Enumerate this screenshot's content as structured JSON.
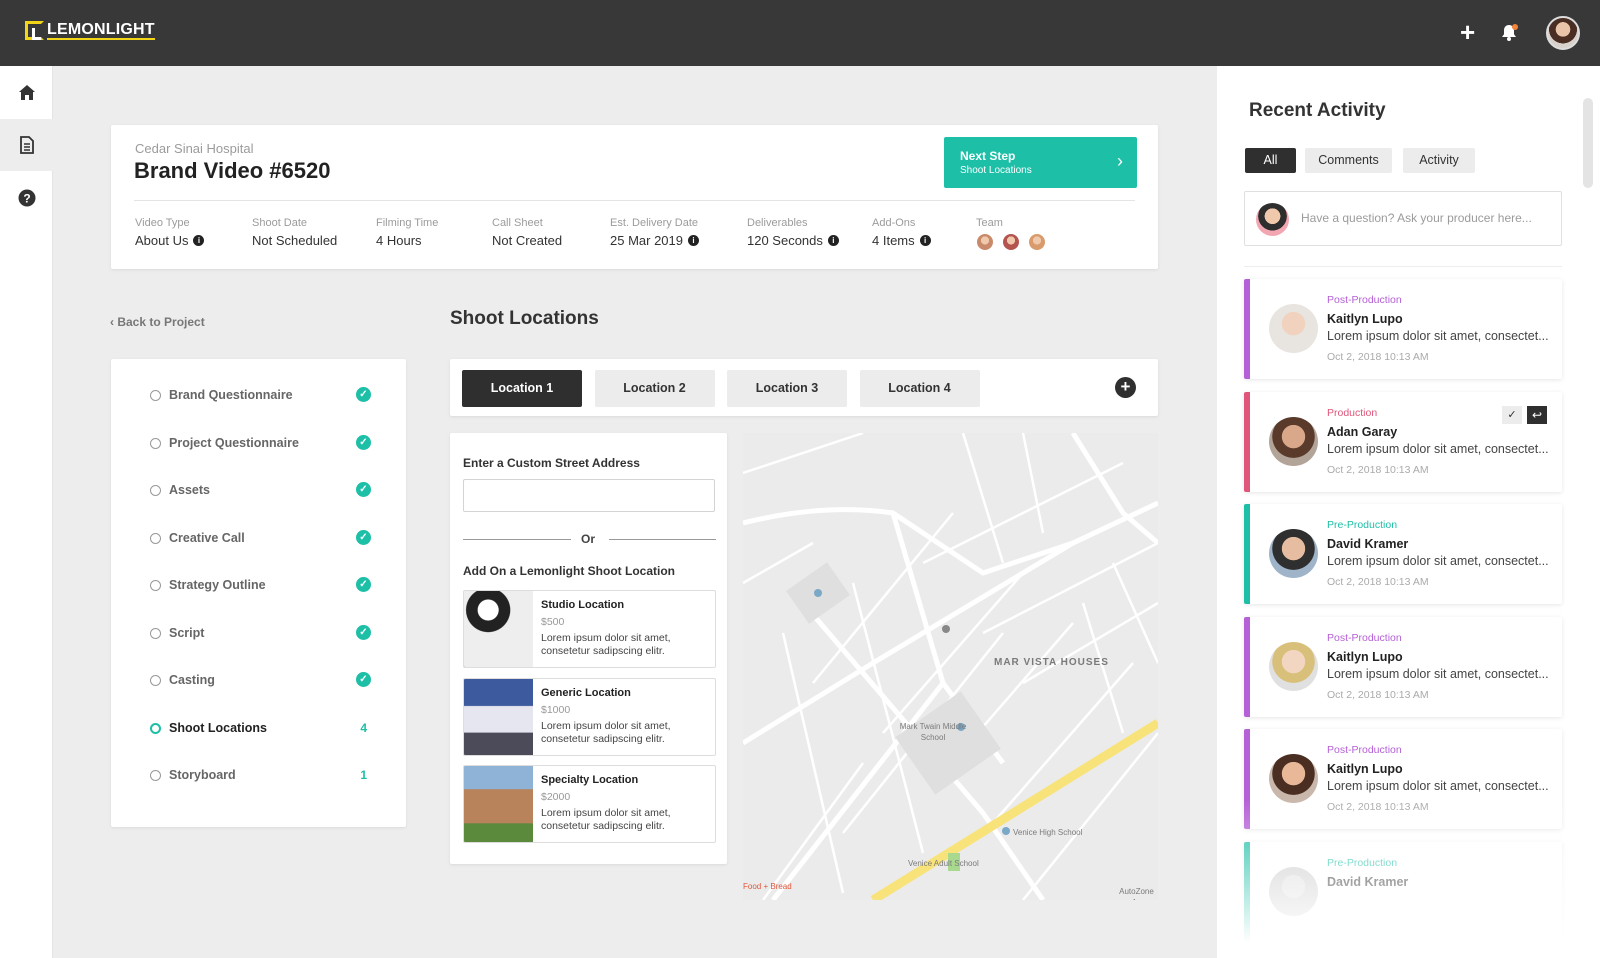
{
  "app": {
    "brand": "LEMONLIGHT"
  },
  "header": {
    "client": "Cedar Sinai Hospital",
    "title": "Brand Video #6520",
    "next_step": {
      "label": "Next Step",
      "sub": "Shoot Locations"
    },
    "meta": [
      {
        "key": "Video Type",
        "value": "About Us",
        "info": true
      },
      {
        "key": "Shoot Date",
        "value": "Not Scheduled",
        "info": false
      },
      {
        "key": "Filming Time",
        "value": "4 Hours",
        "info": false
      },
      {
        "key": "Call Sheet",
        "value": "Not Created",
        "info": false
      },
      {
        "key": "Est. Delivery Date",
        "value": "25 Mar 2019",
        "info": true
      },
      {
        "key": "Deliverables",
        "value": "120 Seconds",
        "info": true
      },
      {
        "key": "Add-Ons",
        "value": "4 Items",
        "info": true
      },
      {
        "key": "Team",
        "value": "",
        "info": false
      }
    ]
  },
  "nav": {
    "back": "Back to Project"
  },
  "steps": [
    {
      "label": "Brand Questionnaire",
      "done": true
    },
    {
      "label": "Project Questionnaire",
      "done": true
    },
    {
      "label": "Assets",
      "done": true
    },
    {
      "label": "Creative Call",
      "done": true
    },
    {
      "label": "Strategy Outline",
      "done": true
    },
    {
      "label": "Script",
      "done": true
    },
    {
      "label": "Casting",
      "done": true
    },
    {
      "label": "Shoot Locations",
      "done": false,
      "count": "4",
      "current": true
    },
    {
      "label": "Storyboard",
      "done": false,
      "count": "1"
    }
  ],
  "main": {
    "title": "Shoot Locations",
    "tabs": [
      "Location 1",
      "Location 2",
      "Location 3",
      "Location 4"
    ],
    "address_label": "Enter a Custom Street Address",
    "or": "Or",
    "addon_label": "Add On a Lemonlight Shoot Location",
    "locations": [
      {
        "name": "Studio Location",
        "price": "$500",
        "desc": "Lorem ipsum dolor sit amet, consetetur sadipscing elitr."
      },
      {
        "name": "Generic Location",
        "price": "$1000",
        "desc": "Lorem ipsum dolor sit amet, consetetur sadipscing elitr."
      },
      {
        "name": "Specialty Location",
        "price": "$2000",
        "desc": "Lorem ipsum dolor sit amet, consetetur sadipscing elitr."
      }
    ],
    "map": {
      "area_label": "MAR VISTA HOUSES",
      "school1": "Mark Twain Middle School",
      "school2": "Venice High School",
      "school3": "Venice Adult School",
      "credit": "AutoZone Au",
      "shop": "Food + Bread"
    }
  },
  "activity": {
    "title": "Recent Activity",
    "filters": [
      "All",
      "Comments",
      "Activity"
    ],
    "ask_placeholder": "Have a question? Ask your producer here...",
    "colors": {
      "post": "#b560d6",
      "production": "#e0567a",
      "pre": "#1dbfa7"
    },
    "items": [
      {
        "stage": "Post-Production",
        "name": "Kaitlyn Lupo",
        "text": "Lorem ipsum dolor sit amet, consectet...",
        "time": "Oct 2, 2018    10:13 AM"
      },
      {
        "stage": "Production",
        "name": "Adan Garay",
        "text": "Lorem ipsum dolor sit amet, consectet...",
        "time": "Oct 2, 2018    10:13 AM"
      },
      {
        "stage": "Pre-Production",
        "name": "David Kramer",
        "text": "Lorem ipsum dolor sit amet, consectet...",
        "time": "Oct 2, 2018    10:13 AM"
      },
      {
        "stage": "Post-Production",
        "name": "Kaitlyn Lupo",
        "text": "Lorem ipsum dolor sit amet, consectet...",
        "time": "Oct 2, 2018    10:13 AM"
      },
      {
        "stage": "Post-Production",
        "name": "Kaitlyn Lupo",
        "text": "Lorem ipsum dolor sit amet, consectet...",
        "time": "Oct 2, 2018    10:13 AM"
      },
      {
        "stage": "Pre-Production",
        "name": "David Kramer",
        "text": "",
        "time": ""
      }
    ]
  }
}
